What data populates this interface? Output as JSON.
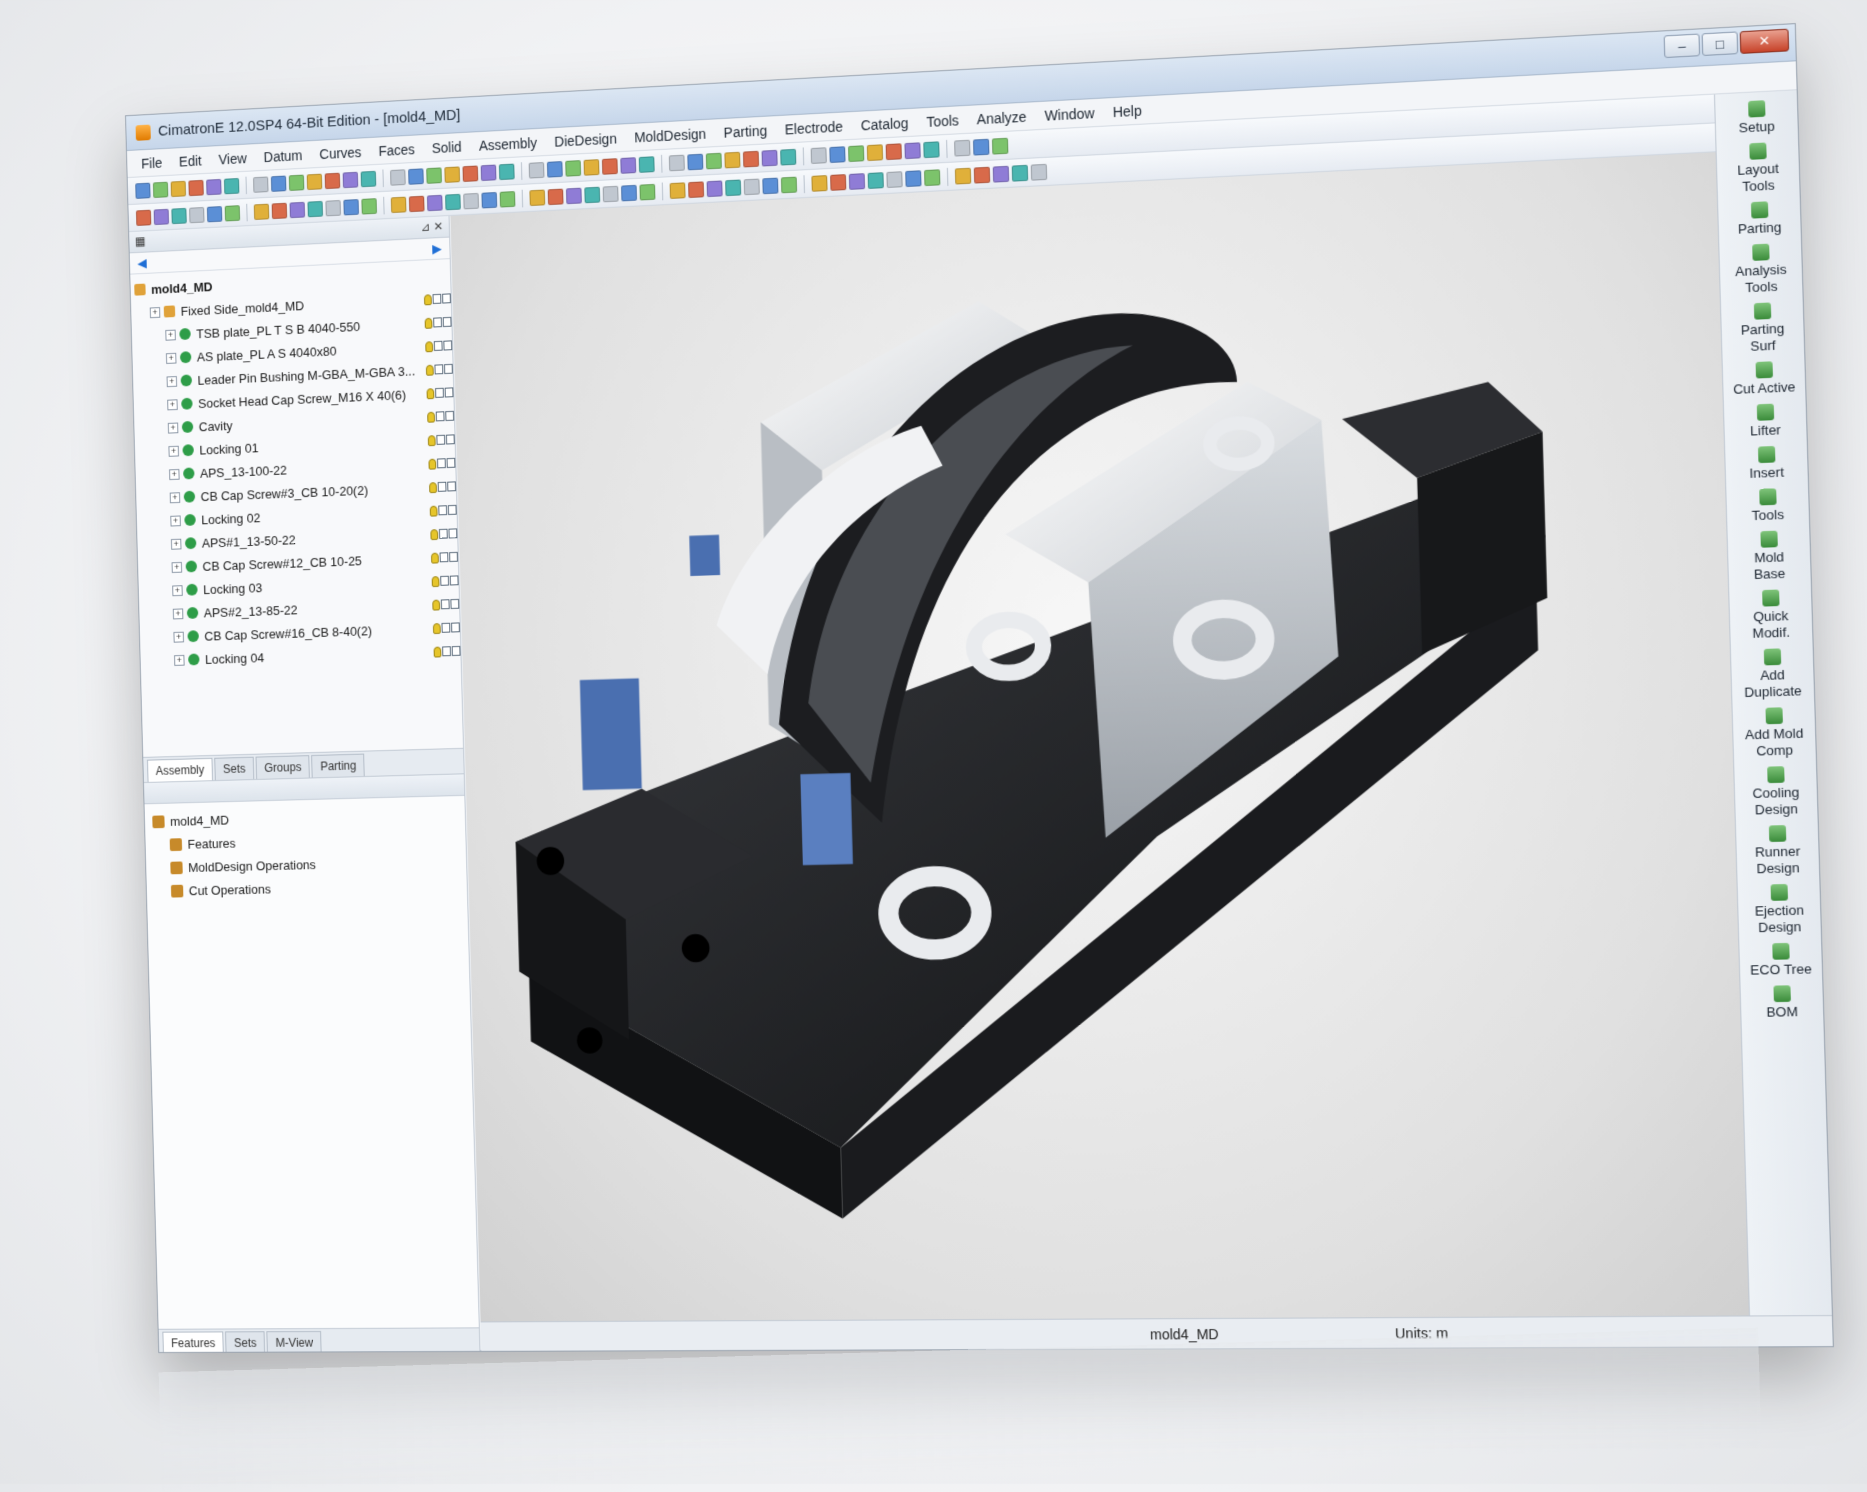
{
  "window": {
    "title": "CimatronE 12.0SP4 64-Bit Edition - [mold4_MD]",
    "controls": {
      "minimize": "–",
      "maximize": "□",
      "close": "✕"
    }
  },
  "menu": [
    "File",
    "Edit",
    "View",
    "Datum",
    "Curves",
    "Faces",
    "Solid",
    "Assembly",
    "DieDesign",
    "MoldDesign",
    "Parting",
    "Electrode",
    "Catalog",
    "Tools",
    "Analyze",
    "Window",
    "Help"
  ],
  "tree": {
    "root": "mold4_MD",
    "items": [
      {
        "label": "Fixed Side_mold4_MD",
        "level": 1,
        "type": "assembly"
      },
      {
        "label": "TSB plate_PL T S B 4040-550",
        "level": 2,
        "type": "part"
      },
      {
        "label": "AS plate_PL A S 4040x80",
        "level": 2,
        "type": "part"
      },
      {
        "label": "Leader Pin Bushing M-GBA_M-GBA 3...",
        "level": 2,
        "type": "part"
      },
      {
        "label": "Socket Head Cap Screw_M16 X 40(6)",
        "level": 2,
        "type": "part"
      },
      {
        "label": "Cavity",
        "level": 2,
        "type": "part"
      },
      {
        "label": "Locking 01",
        "level": 2,
        "type": "part"
      },
      {
        "label": "APS_13-100-22",
        "level": 2,
        "type": "part"
      },
      {
        "label": "CB Cap Screw#3_CB 10-20(2)",
        "level": 2,
        "type": "part"
      },
      {
        "label": "Locking 02",
        "level": 2,
        "type": "part"
      },
      {
        "label": "APS#1_13-50-22",
        "level": 2,
        "type": "part"
      },
      {
        "label": "CB Cap Screw#12_CB 10-25",
        "level": 2,
        "type": "part"
      },
      {
        "label": "Locking 03",
        "level": 2,
        "type": "part"
      },
      {
        "label": "APS#2_13-85-22",
        "level": 2,
        "type": "part"
      },
      {
        "label": "CB Cap Screw#16_CB 8-40(2)",
        "level": 2,
        "type": "part"
      },
      {
        "label": "Locking 04",
        "level": 2,
        "type": "part"
      }
    ],
    "tabs": [
      "Assembly",
      "Sets",
      "Groups",
      "Parting"
    ]
  },
  "features": {
    "root": "mold4_MD",
    "items": [
      "Features",
      "MoldDesign Operations",
      "Cut Operations"
    ],
    "tabs": [
      "Features",
      "Sets",
      "M-View"
    ]
  },
  "right_toolbar": [
    "Setup",
    "Layout\nTools",
    "Parting",
    "Analysis\nTools",
    "Parting\nSurf",
    "Cut Active",
    "Lifter",
    "Insert",
    "Tools",
    "Mold\nBase",
    "Quick\nModif.",
    "Add\nDuplicate",
    "Add Mold\nComp",
    "Cooling\nDesign",
    "Runner\nDesign",
    "Ejection\nDesign",
    "ECO Tree",
    "BOM"
  ],
  "status": {
    "part": "mold4_MD",
    "units": "Units: m"
  },
  "colors": {
    "accent": "#1f6fd6",
    "mold_dark": "#1e1f22",
    "mold_light": "#e8eaec",
    "mold_blue": "#4a6fb0"
  }
}
